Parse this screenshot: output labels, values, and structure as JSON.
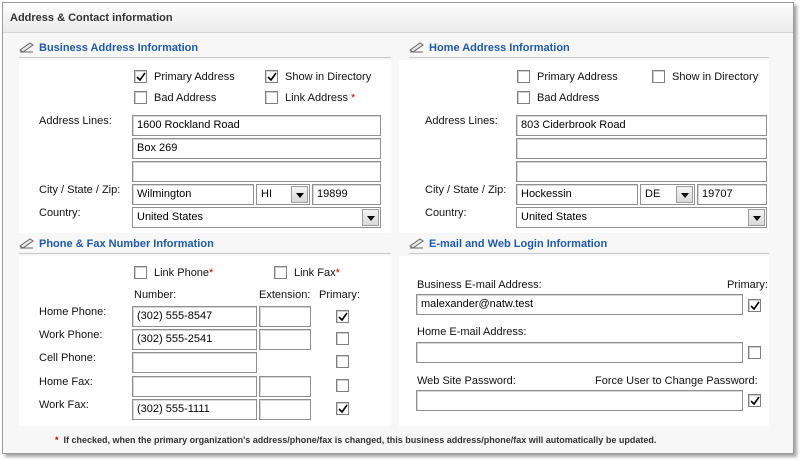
{
  "panel": {
    "title": "Address & Contact information"
  },
  "business_address": {
    "title": "Business Address Information",
    "primary_address": {
      "label": "Primary Address",
      "checked": true
    },
    "show_in_directory": {
      "label": "Show in Directory",
      "checked": true
    },
    "bad_address": {
      "label": "Bad Address",
      "checked": false
    },
    "link_address": {
      "label": "Link Address",
      "required_mark": "*",
      "checked": false
    },
    "address_lines_label": "Address Lines:",
    "address_line1": "1600 Rockland Road",
    "address_line2": "Box 269",
    "address_line3": "",
    "city_state_zip_label": "City / State / Zip:",
    "city": "Wilmington",
    "state": "HI",
    "zip": "19899",
    "country_label": "Country:",
    "country": "United States"
  },
  "home_address": {
    "title": "Home Address Information",
    "primary_address": {
      "label": "Primary Address",
      "checked": false
    },
    "show_in_directory": {
      "label": "Show in Directory",
      "checked": false
    },
    "bad_address": {
      "label": "Bad Address",
      "checked": false
    },
    "address_lines_label": "Address Lines:",
    "address_line1": "803 Ciderbrook Road",
    "address_line2": "",
    "address_line3": "",
    "city_state_zip_label": "City / State / Zip:",
    "city": "Hockessin",
    "state": "DE",
    "zip": "19707",
    "country_label": "Country:",
    "country": "United States"
  },
  "phone_fax": {
    "title": "Phone & Fax Number Information",
    "link_phone": {
      "label": "Link Phone",
      "required_mark": "*",
      "checked": false
    },
    "link_fax": {
      "label": "Link Fax",
      "required_mark": "*",
      "checked": false
    },
    "col_number": "Number:",
    "col_extension": "Extension:",
    "col_primary": "Primary:",
    "rows": [
      {
        "label": "Home Phone:",
        "number": "(302) 555-8547",
        "extension": "",
        "primary": true
      },
      {
        "label": "Work Phone:",
        "number": "(302) 555-2541",
        "extension": "",
        "primary": false
      },
      {
        "label": "Cell Phone:",
        "number": "",
        "extension": "",
        "primary": false
      },
      {
        "label": "Home Fax:",
        "number": "",
        "extension": "",
        "primary": false
      },
      {
        "label": "Work Fax:",
        "number": "(302) 555-1111",
        "extension": "",
        "primary": true
      }
    ]
  },
  "email_web": {
    "title": "E-mail and Web Login Information",
    "business_email_label": "Business E-mail Address:",
    "primary_label": "Primary:",
    "business_email": "malexander@natw.test",
    "business_email_primary": true,
    "home_email_label": "Home E-mail Address:",
    "home_email": "",
    "home_email_primary": false,
    "web_password_label": "Web Site Password:",
    "force_change_label": "Force User to Change Password:",
    "web_password": "",
    "force_change": true
  },
  "footnote": {
    "mark": "*",
    "text": "If checked, when the primary organization's address/phone/fax is changed, this business address/phone/fax will automatically be updated."
  },
  "colors": {
    "section_title": "#1f5aa8",
    "required_mark": "#d00000",
    "panel_border": "#9a9a9a"
  },
  "icons": {
    "section_icon": "pencil-icon",
    "checkmark": "checkmark-icon",
    "dropdown": "chevron-down-icon"
  }
}
